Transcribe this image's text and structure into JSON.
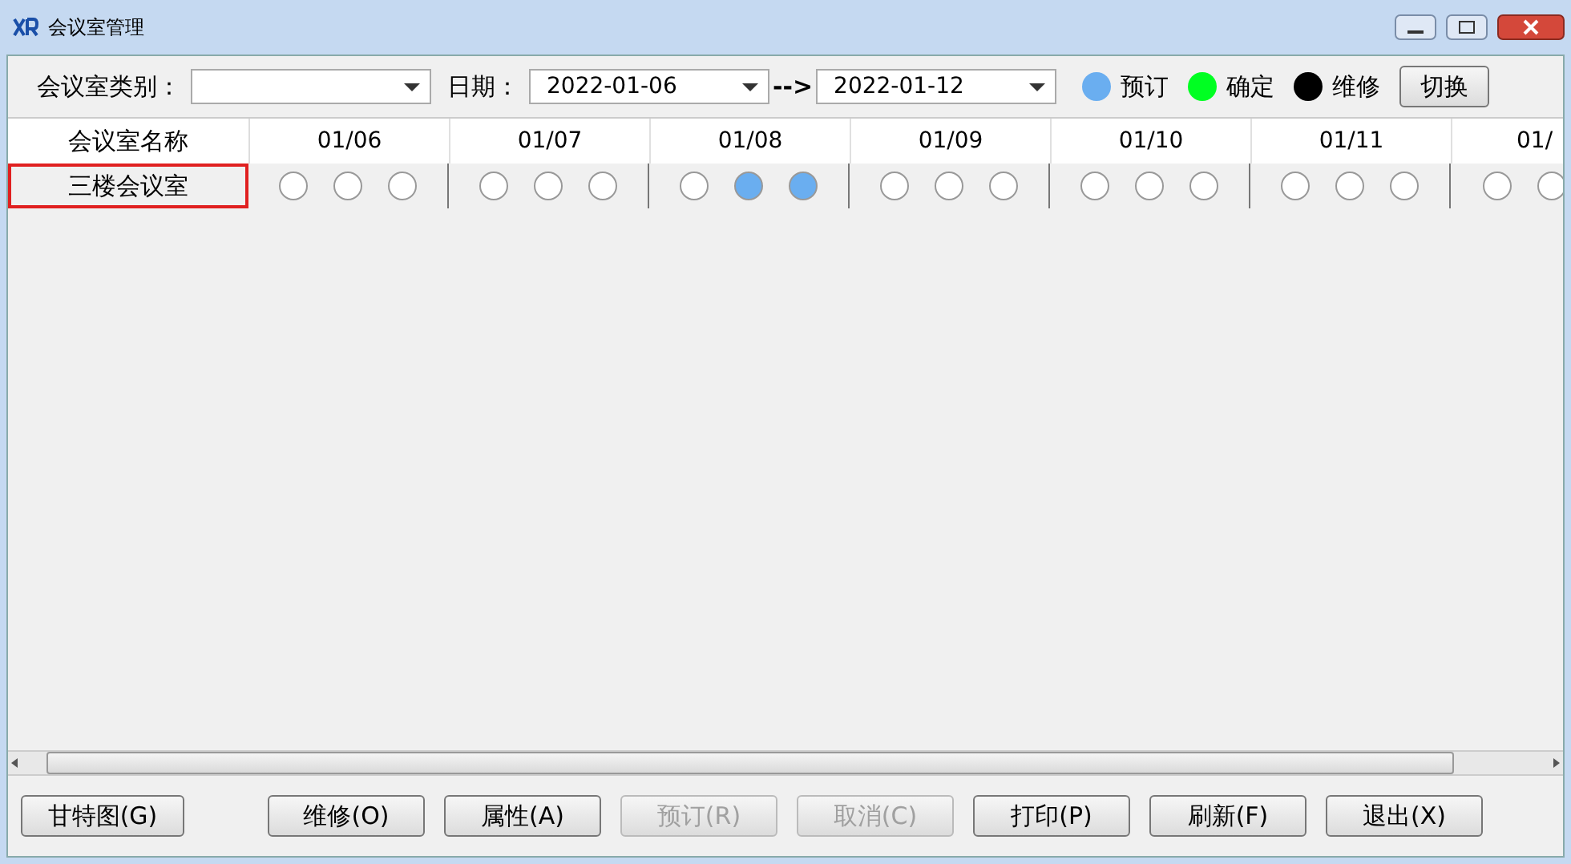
{
  "window": {
    "title": "会议室管理"
  },
  "filters": {
    "category_label": "会议室类别：",
    "date_label": "日期：",
    "date_from": "2022-01-06",
    "arrow": "-->",
    "date_to": "2022-01-12"
  },
  "legend": [
    {
      "kind": "booked",
      "label": "预订",
      "color": "#6aaef0"
    },
    {
      "kind": "confirmed",
      "label": "确定",
      "color": "#00ff22"
    },
    {
      "kind": "repair",
      "label": "维修",
      "color": "#000000"
    }
  ],
  "switch_button": "切换",
  "table": {
    "name_header": "会议室名称",
    "days": [
      {
        "label": "01/06"
      },
      {
        "label": "01/07"
      },
      {
        "label": "01/08"
      },
      {
        "label": "01/09"
      },
      {
        "label": "01/10"
      },
      {
        "label": "01/11"
      },
      {
        "label": "01/"
      }
    ],
    "rows": [
      {
        "name": "三楼会议室",
        "selected": true,
        "days": [
          {
            "slots": [
              {
                "kind": "free"
              },
              {
                "kind": "free"
              },
              {
                "kind": "free"
              }
            ]
          },
          {
            "slots": [
              {
                "kind": "free"
              },
              {
                "kind": "free"
              },
              {
                "kind": "free"
              }
            ]
          },
          {
            "slots": [
              {
                "kind": "free"
              },
              {
                "kind": "booked"
              },
              {
                "kind": "booked"
              }
            ]
          },
          {
            "slots": [
              {
                "kind": "free"
              },
              {
                "kind": "free"
              },
              {
                "kind": "free"
              }
            ]
          },
          {
            "slots": [
              {
                "kind": "free"
              },
              {
                "kind": "free"
              },
              {
                "kind": "free"
              }
            ]
          },
          {
            "slots": [
              {
                "kind": "free"
              },
              {
                "kind": "free"
              },
              {
                "kind": "free"
              }
            ]
          },
          {
            "slots": [
              {
                "kind": "free"
              },
              {
                "kind": "free"
              }
            ]
          }
        ]
      }
    ]
  },
  "buttons": [
    {
      "label": "甘特图(G)",
      "disabled": false
    },
    {
      "label": "维修(O)",
      "disabled": false
    },
    {
      "label": "属性(A)",
      "disabled": false
    },
    {
      "label": "预订(R)",
      "disabled": true
    },
    {
      "label": "取消(C)",
      "disabled": true
    },
    {
      "label": "打印(P)",
      "disabled": false
    },
    {
      "label": "刷新(F)",
      "disabled": false
    },
    {
      "label": "退出(X)",
      "disabled": false
    }
  ]
}
